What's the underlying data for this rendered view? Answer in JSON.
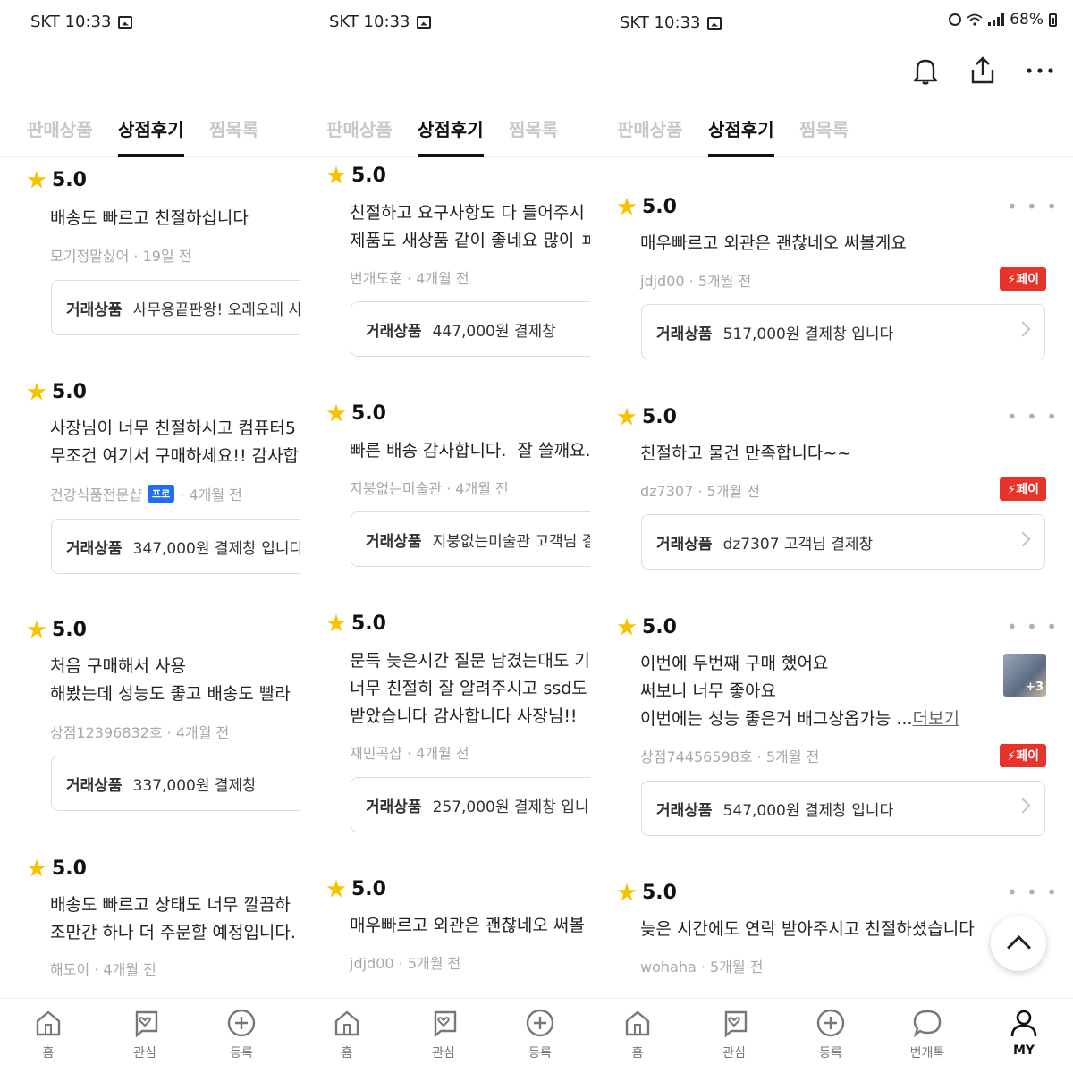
{
  "status": {
    "carrier_time": "SKT 10:33",
    "battery": "68%"
  },
  "tabs": [
    "판매상품",
    "상점후기",
    "찜목록"
  ],
  "trade_label": "거래상품",
  "panels": [
    {
      "reviews": [
        {
          "rating": "5.0",
          "lines": "배송도 빠르고 친절하십니다",
          "meta": "모기정말싫어 · 19일 전",
          "trade": "사무용끝판왕! 오래오래 사"
        },
        {
          "rating": "5.0",
          "lines": "사장님이 너무 친절하시고 컴퓨터5\n무조건 여기서 구매하세요!! 감사합",
          "meta": "건강식품전문샵",
          "pro": "프로",
          "meta_after": "· 4개월 전",
          "trade": "347,000원 결제창 입니다"
        },
        {
          "rating": "5.0",
          "lines": "처음 구매해서 사용\n해봤는데 성능도 좋고 배송도 빨라",
          "meta": "상점12396832호 · 4개월 전",
          "trade": "337,000원 결제창"
        },
        {
          "rating": "5.0",
          "lines": "배송도 빠르고 상태도 너무 깔끔하\n조만간 하나 더 주문할 예정입니다.",
          "meta": "해도이 · 4개월 전"
        }
      ],
      "nav": [
        "홈",
        "관심",
        "등록"
      ]
    },
    {
      "reviews": [
        {
          "rating": "5.0",
          "lines": "친절하고 요구사항도 다 들어주시\n제품도 새상품 같이 좋네요 많이 ㅍ",
          "meta": "번개도훈 · 4개월 전",
          "trade": "447,000원 결제창"
        },
        {
          "rating": "5.0",
          "lines": "빠른 배송 감사합니다.  잘 쓸깨요.",
          "meta": "지붕없는미술관 · 4개월 전",
          "trade": "지붕없는미술관 고객님 결"
        },
        {
          "rating": "5.0",
          "lines": "문득 늦은시간 질문 남겼는대도 기\n너무 친절히 잘 알려주시고 ssd도\n받았습니다 감사합니다 사장님!!",
          "meta": "재민곡샵 · 4개월 전",
          "trade": "257,000원 결제창 입니다"
        },
        {
          "rating": "5.0",
          "lines": "매우빠르고 외관은 괜찮네오 써볼",
          "meta": "jdjd00 · 5개월 전"
        }
      ],
      "nav": [
        "홈",
        "관심",
        "등록"
      ]
    },
    {
      "reviews": [
        {
          "rating": "5.0",
          "lines": "매우빠르고 외관은 괜찮네오 써볼게요",
          "meta": "jdjd00 · 5개월 전",
          "pay": "페이",
          "trade": "517,000원 결제창 입니다"
        },
        {
          "rating": "5.0",
          "lines": "친절하고 물건 만족합니다~~",
          "meta": "dz7307 · 5개월 전",
          "pay": "페이",
          "trade": "dz7307 고객님 결제창"
        },
        {
          "rating": "5.0",
          "lines": "이번에 두번째 구매 했어요\n써보니 너무 좋아요\n이번에는 성능 좋은거 배그상옵가능 ...",
          "more": "더보기",
          "thumb_count": "+3",
          "meta": "상점74456598호 · 5개월 전",
          "pay": "페이",
          "trade": "547,000원 결제창 입니다"
        },
        {
          "rating": "5.0",
          "lines": "늦은 시간에도 연락 받아주시고 친절하셨습니다",
          "meta": "wohaha · 5개월 전"
        }
      ],
      "nav": [
        "홈",
        "관심",
        "등록",
        "번개톡",
        "MY"
      ]
    }
  ],
  "icons": {
    "bell": "bell-icon",
    "share": "share-icon",
    "more": "more-icon",
    "star": "star-icon",
    "home": "home-icon",
    "heart": "heart-chat-icon",
    "plus": "plus-circle-icon",
    "chat": "chat-icon",
    "user": "user-icon",
    "up": "arrow-up-icon"
  },
  "colors": {
    "star": "#f7c300",
    "pay_badge": "#e8332a",
    "pro_badge": "#1e6ff1",
    "tab_inactive": "#c8c8c8"
  }
}
